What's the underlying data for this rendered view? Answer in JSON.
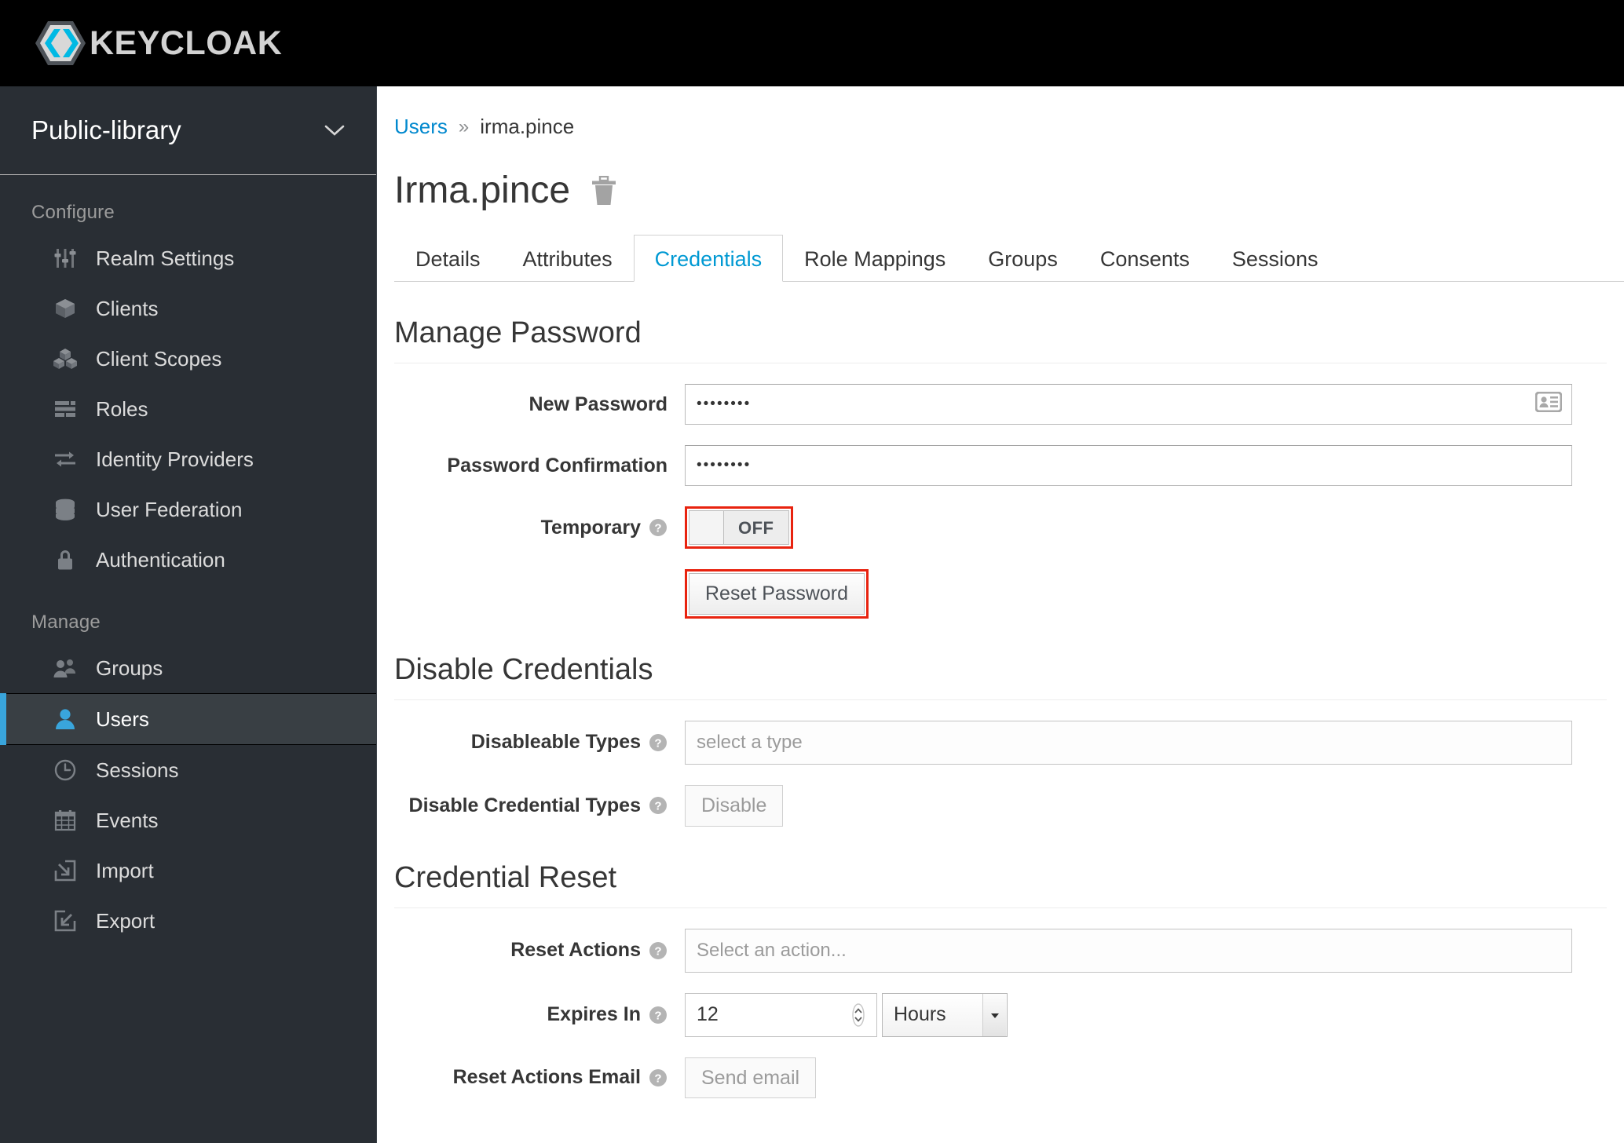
{
  "brand": {
    "name": "KEYCLOAK",
    "logo_icon": "keycloak-logo-icon",
    "accent_color": "#39a5dc",
    "masthead_bg": "#000000"
  },
  "sidebar": {
    "realm": {
      "name": "Public-library",
      "chevron_icon": "chevron-down-icon"
    },
    "groups": [
      {
        "label": "Configure",
        "items": [
          {
            "label": "Realm Settings",
            "icon": "sliders-icon",
            "active": false
          },
          {
            "label": "Clients",
            "icon": "cube-icon",
            "active": false
          },
          {
            "label": "Client Scopes",
            "icon": "cubes-icon",
            "active": false
          },
          {
            "label": "Roles",
            "icon": "list-bars-icon",
            "active": false
          },
          {
            "label": "Identity Providers",
            "icon": "exchange-arrows-icon",
            "active": false
          },
          {
            "label": "User Federation",
            "icon": "database-icon",
            "active": false
          },
          {
            "label": "Authentication",
            "icon": "lock-icon",
            "active": false
          }
        ]
      },
      {
        "label": "Manage",
        "items": [
          {
            "label": "Groups",
            "icon": "users-group-icon",
            "active": false
          },
          {
            "label": "Users",
            "icon": "user-icon",
            "active": true
          },
          {
            "label": "Sessions",
            "icon": "clock-icon",
            "active": false
          },
          {
            "label": "Events",
            "icon": "calendar-icon",
            "active": false
          },
          {
            "label": "Import",
            "icon": "import-arrow-icon",
            "active": false
          },
          {
            "label": "Export",
            "icon": "export-arrow-icon",
            "active": false
          }
        ]
      }
    ]
  },
  "main": {
    "breadcrumb": {
      "parent": "Users",
      "separator": "»",
      "current": "irma.pince"
    },
    "page_title": "Irma.pince",
    "delete_icon": "trash-icon",
    "tabs": [
      {
        "label": "Details",
        "active": false
      },
      {
        "label": "Attributes",
        "active": false
      },
      {
        "label": "Credentials",
        "active": true
      },
      {
        "label": "Role Mappings",
        "active": false
      },
      {
        "label": "Groups",
        "active": false
      },
      {
        "label": "Consents",
        "active": false
      },
      {
        "label": "Sessions",
        "active": false
      }
    ],
    "manage_password": {
      "title": "Manage Password",
      "new_password": {
        "label": "New Password",
        "value": "••••••••",
        "autofill_icon": "contact-card-icon"
      },
      "password_confirmation": {
        "label": "Password Confirmation",
        "value": "••••••••"
      },
      "temporary": {
        "label": "Temporary",
        "help_icon": "help-circle-icon",
        "state": "OFF",
        "highlighted": true,
        "highlight_color": "#e8230f"
      },
      "reset_password_button": {
        "label": "Reset Password",
        "highlighted": true,
        "highlight_color": "#e8230f"
      }
    },
    "disable_credentials": {
      "title": "Disable Credentials",
      "disableable_types": {
        "label": "Disableable Types",
        "help_icon": "help-circle-icon",
        "placeholder": "select a type",
        "value": ""
      },
      "disable_credential_types": {
        "label": "Disable Credential Types",
        "help_icon": "help-circle-icon",
        "button_label": "Disable",
        "disabled": true
      }
    },
    "credential_reset": {
      "title": "Credential Reset",
      "reset_actions": {
        "label": "Reset Actions",
        "help_icon": "help-circle-icon",
        "placeholder": "Select an action...",
        "value": ""
      },
      "expires_in": {
        "label": "Expires In",
        "help_icon": "help-circle-icon",
        "value": "12",
        "unit": "Hours",
        "spinner_icon": "stepper-arrows-icon",
        "caret_icon": "caret-down-icon"
      },
      "reset_actions_email": {
        "label": "Reset Actions Email",
        "help_icon": "help-circle-icon",
        "button_label": "Send email",
        "disabled": true
      }
    }
  }
}
